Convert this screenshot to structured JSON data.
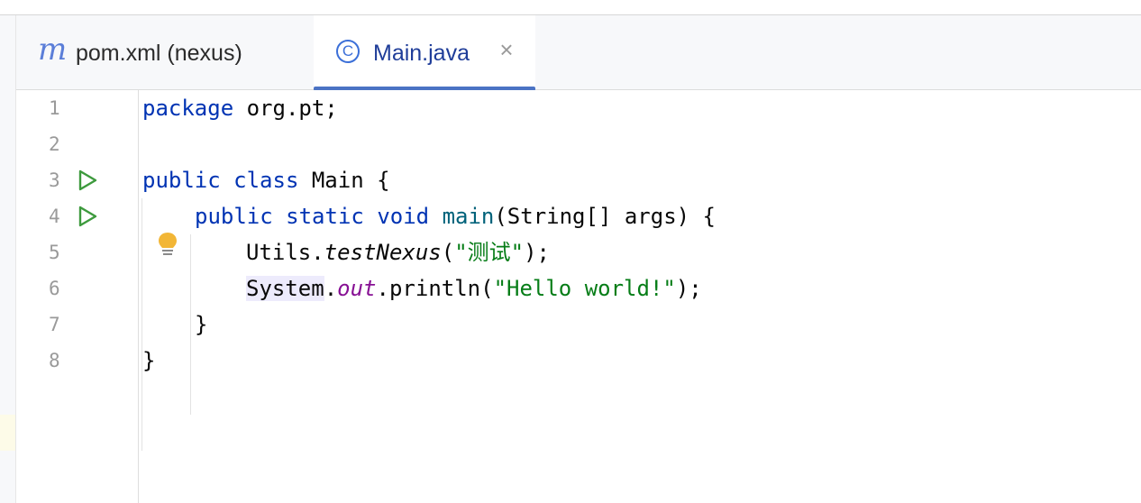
{
  "tabs": [
    {
      "icon": "maven-module-icon",
      "glyph": "m",
      "label": "pom.xml (nexus)",
      "active": false
    },
    {
      "icon": "java-class-icon",
      "glyph": "C",
      "label": "Main.java",
      "active": true,
      "close": "×"
    }
  ],
  "editor": {
    "caret_line": 6,
    "lines": [
      {
        "number": "1",
        "run": false
      },
      {
        "number": "2",
        "run": false
      },
      {
        "number": "3",
        "run": true
      },
      {
        "number": "4",
        "run": true
      },
      {
        "number": "5",
        "run": false
      },
      {
        "number": "6",
        "run": false
      },
      {
        "number": "7",
        "run": false
      },
      {
        "number": "8",
        "run": false
      }
    ],
    "code": {
      "l1": {
        "kw": "package",
        "rest": " org.pt;"
      },
      "l3": {
        "kw1": "public",
        "kw2": "class",
        "rest": " Main {"
      },
      "l4": {
        "kw1": "public",
        "kw2": "static",
        "kw3": "void",
        "fn": "main",
        "rest": "(String[] args) {"
      },
      "l5": {
        "cls": "Utils.",
        "method": "testNexus",
        "open": "(",
        "str": "\"测试\"",
        "close": ");"
      },
      "l6": {
        "cls": "System",
        "dot": ".",
        "field": "out",
        "call": ".println(",
        "str": "\"Hello world!\"",
        "close": ");"
      },
      "l7": {
        "text": "}"
      },
      "l8": {
        "text": "}"
      }
    }
  },
  "colors": {
    "keyword": "#0033b3",
    "string": "#067d17",
    "field": "#871094",
    "accent": "#4b73c4",
    "run": "#3d9a3d",
    "bulb": "#f2b636"
  }
}
